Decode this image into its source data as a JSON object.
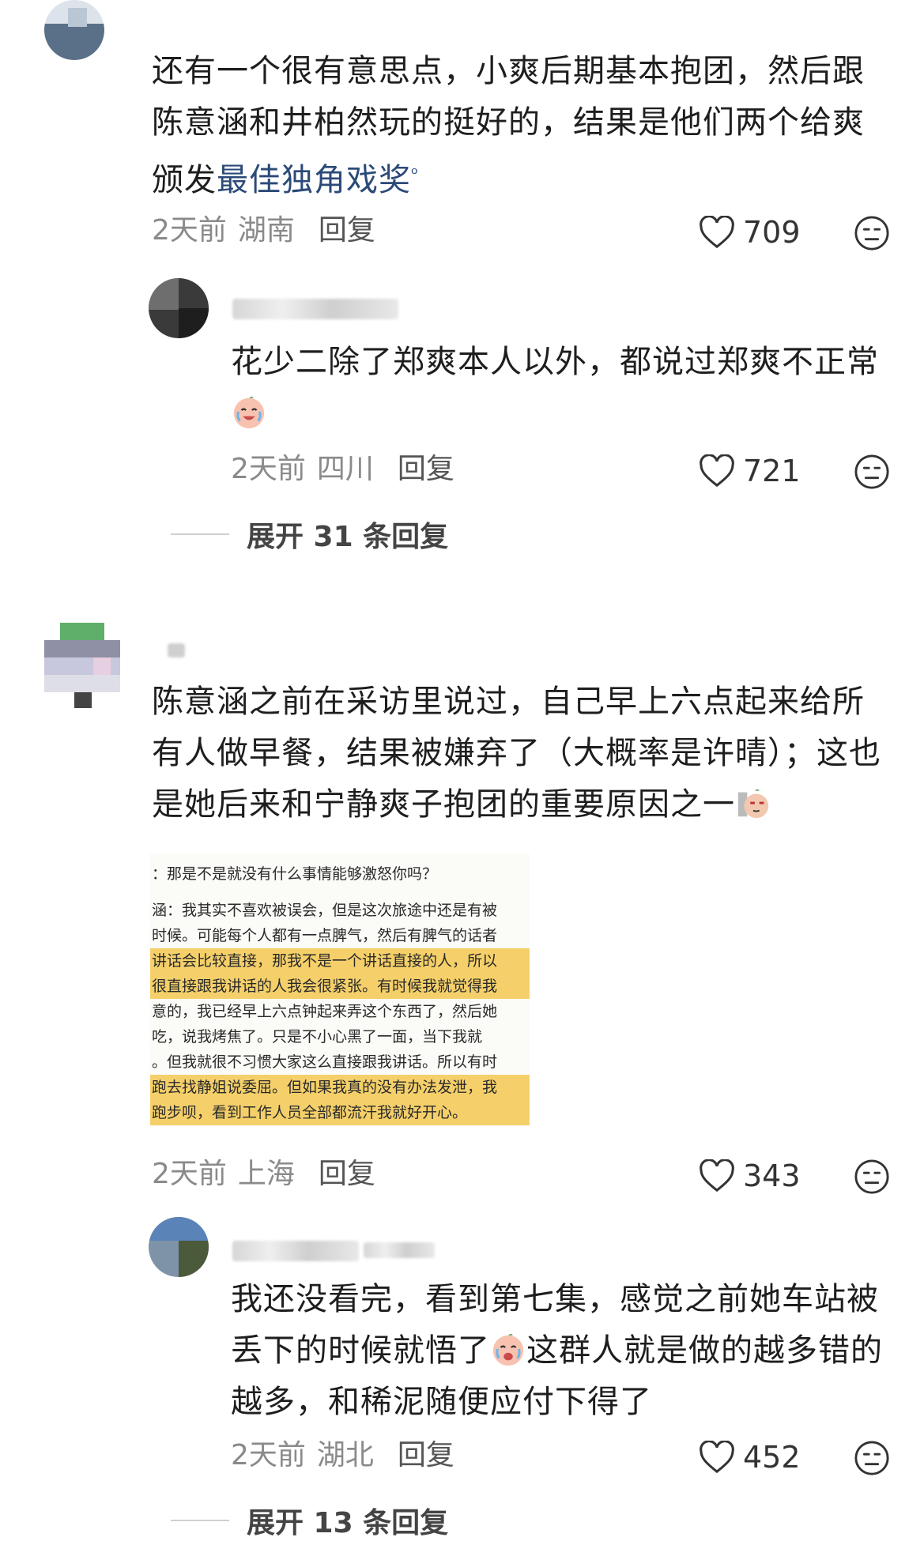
{
  "comments": [
    {
      "text_plain": "还有一个很有意思点，小爽后期基本抱团，然后跟陈意涵和井柏然玩的挺好的，结果是他们两个给爽颁发",
      "link_text": "最佳独角戏奖",
      "time": "2天前",
      "location": "湖南",
      "reply_label": "回复",
      "likes": "709"
    },
    {
      "text": "花少二除了郑爽本人以外，都说过郑爽不正常",
      "time": "2天前",
      "location": "四川",
      "reply_label": "回复",
      "likes": "721"
    },
    {
      "text": "陈意涵之前在采访里说过，自己早上六点起来给所有人做早餐，结果被嫌弃了（大概率是许晴）；这也是她后来和宁静爽子抱团的重要原因之一",
      "time": "2天前",
      "location": "上海",
      "reply_label": "回复",
      "likes": "343"
    },
    {
      "text_a": "我还没看完，看到第七集，感觉之前她车站被丢下的时候就悟了",
      "text_b": "这群人就是做的越多错的越多，和稀泥随便应付下得了",
      "time": "2天前",
      "location": "湖北",
      "reply_label": "回复",
      "likes": "452"
    }
  ],
  "expand": [
    {
      "label": "展开 31 条回复"
    },
    {
      "label": "展开 13 条回复"
    }
  ],
  "screenshot_lines": [
    "：那是不是就没有什么事情能够激怒你吗？",
    "涵：我其实不喜欢被误会，但是这次旅途中还是有被",
    "时候。可能每个人都有一点脾气，然后有脾气的话者",
    "讲话会比较直接，那我不是一个讲话直接的人，所以",
    "很直接跟我讲话的人我会很紧张。有时候我就觉得我",
    "意的，我已经早上六点钟起来弄这个东西了，然后她",
    "吃，说我烤焦了。只是不小心黑了一面，当下我就",
    "。但我就很不习惯大家这么直接跟我讲话。所以有时",
    "跑去找静姐说委屈。但如果我真的没有办法发泄，我",
    "跑步呗，看到工作人员全部都流汗我就好开心。"
  ],
  "colors": {
    "link": "#2c4a78",
    "meta": "#8a8a8a",
    "highlight": "#f5d06a"
  }
}
